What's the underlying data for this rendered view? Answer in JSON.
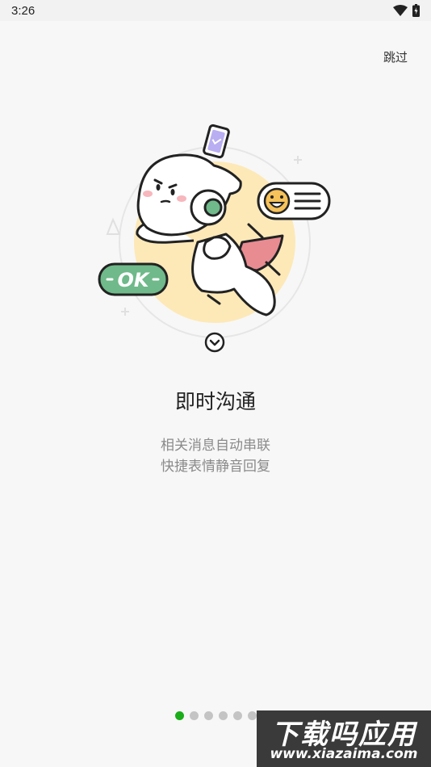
{
  "status_bar": {
    "time": "3:26",
    "icons": [
      "wifi-icon",
      "battery-icon"
    ]
  },
  "skip_label": "跳过",
  "illustration": {
    "badge_text": "OK",
    "icons": [
      "phone-icon",
      "smiley-icon",
      "chevron-down-icon"
    ]
  },
  "title": "即时沟通",
  "subtitle_lines": [
    "相关消息自动串联",
    "快捷表情静音回复"
  ],
  "pager": {
    "total": 6,
    "active_index": 0
  },
  "watermark": {
    "title": "下载吗应用",
    "url": "www.xiazaima.com"
  },
  "colors": {
    "active_dot": "#1aad19",
    "inactive_dot": "#c4c4c4",
    "ok_badge": "#6fb98a",
    "circle": "#fde9b8",
    "cape": "#e88c92"
  }
}
